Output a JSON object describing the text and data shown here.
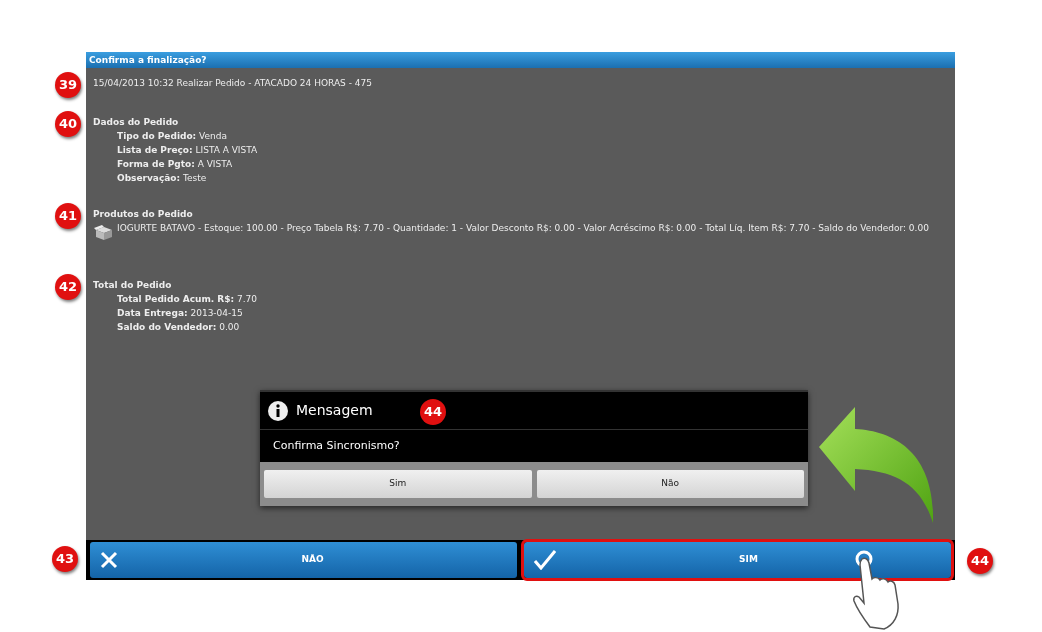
{
  "window": {
    "title": "Confirma a finalização?"
  },
  "header": {
    "text": "15/04/2013 10:32 Realizar Pedido - ATACADO 24 HORAS - 475",
    "callout": "39"
  },
  "sections": [
    {
      "kind": "fields",
      "title": "Dados do Pedido",
      "callout": "40",
      "fields": [
        {
          "label": "Tipo do Pedido:",
          "value": "Venda"
        },
        {
          "label": "Lista de Preço:",
          "value": "LISTA A VISTA"
        },
        {
          "label": "Forma de Pgto:",
          "value": "A VISTA"
        },
        {
          "label": "Observação:",
          "value": "Teste"
        }
      ]
    },
    {
      "kind": "products",
      "title": "Produtos do Pedido",
      "callout": "41",
      "products": [
        "IOGURTE BATAVO - Estoque: 100.00 - Preço Tabela R$: 7.70 - Quantidade: 1 - Valor Desconto R$: 0.00 - Valor Acréscimo R$: 0.00 - Total Líq. Item R$: 7.70 - Saldo do Vendedor: 0.00"
      ]
    },
    {
      "kind": "fields",
      "title": "Total do Pedido",
      "callout": "42",
      "fields": [
        {
          "label": "Total Pedido Acum. R$:",
          "value": "7.70"
        },
        {
          "label": "Data Entrega:",
          "value": "2013-04-15"
        },
        {
          "label": "Saldo do Vendedor:",
          "value": "0.00"
        }
      ]
    }
  ],
  "dialog": {
    "title": "Mensagem",
    "callout": "44",
    "message": "Confirma Sincronismo?",
    "buttons": [
      "Sim",
      "Não"
    ]
  },
  "actions": [
    {
      "kind": "cancel",
      "label": "NÃO",
      "callout": "43",
      "highlighted": false
    },
    {
      "kind": "confirm",
      "label": "SIM",
      "callout": "44",
      "highlighted": true
    }
  ]
}
